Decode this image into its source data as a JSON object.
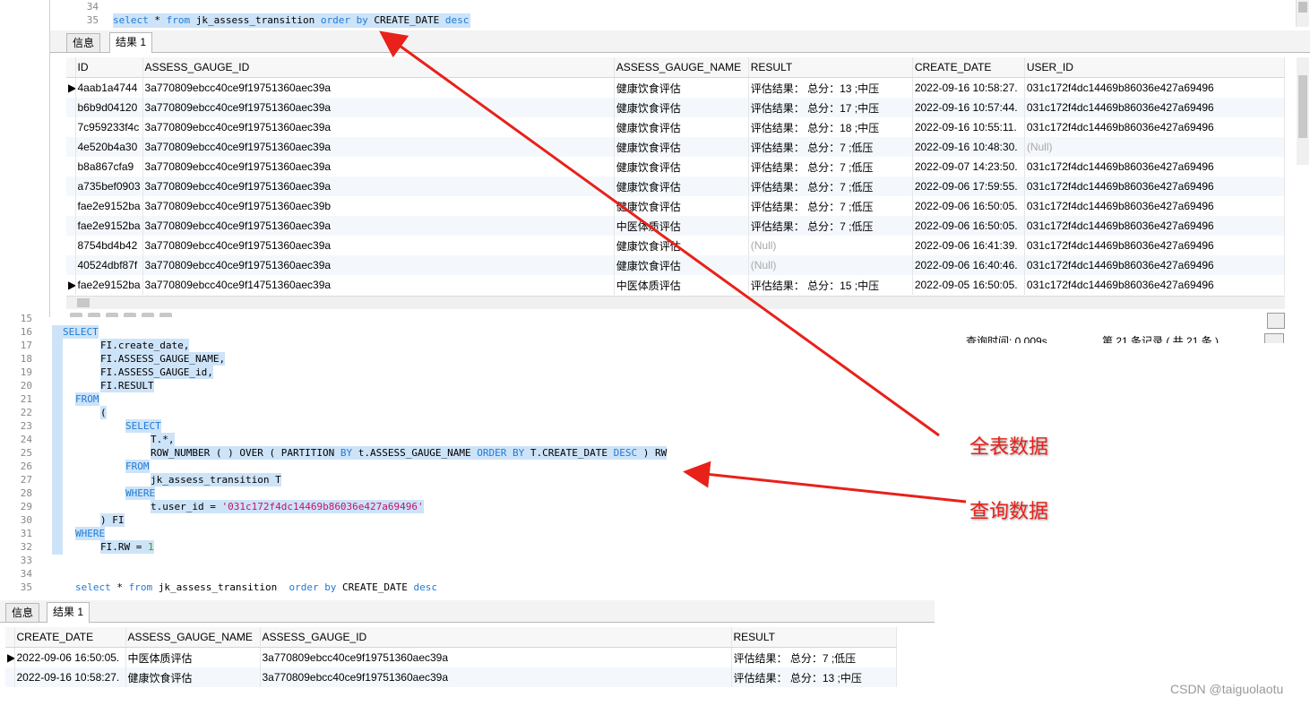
{
  "top": {
    "editor_lines": [
      {
        "n": "34",
        "code": ""
      },
      {
        "n": "35",
        "code_parts": [
          "select",
          " * ",
          "from",
          " jk_assess_transition  ",
          "order by",
          " CREATE_DATE ",
          "desc"
        ]
      }
    ],
    "tabs": [
      "信息",
      "结果 1"
    ],
    "columns": [
      "ID",
      "ASSESS_GAUGE_ID",
      "ASSESS_GAUGE_NAME",
      "RESULT",
      "CREATE_DATE",
      "USER_ID"
    ],
    "rows": [
      [
        "4aab1a4744",
        "3a770809ebcc40ce9f19751360aec39a",
        "健康饮食评估",
        "评估结果： 总分：13 ;中压",
        "2022-09-16 10:58:27.",
        "031c172f4dc14469b86036e427a69496"
      ],
      [
        "b6b9d04120",
        "3a770809ebcc40ce9f19751360aec39a",
        "健康饮食评估",
        "评估结果： 总分：17 ;中压",
        "2022-09-16 10:57:44.",
        "031c172f4dc14469b86036e427a69496"
      ],
      [
        "7c959233f4c",
        "3a770809ebcc40ce9f19751360aec39a",
        "健康饮食评估",
        "评估结果： 总分：18 ;中压",
        "2022-09-16 10:55:11.",
        "031c172f4dc14469b86036e427a69496"
      ],
      [
        "4e520b4a30",
        "3a770809ebcc40ce9f19751360aec39a",
        "健康饮食评估",
        "评估结果： 总分：7 ;低压",
        "2022-09-16 10:48:30.",
        "(Null)"
      ],
      [
        "b8a867cfa9",
        "3a770809ebcc40ce9f19751360aec39a",
        "健康饮食评估",
        "评估结果： 总分：7 ;低压",
        "2022-09-07 14:23:50.",
        "031c172f4dc14469b86036e427a69496"
      ],
      [
        "a735bef0903",
        "3a770809ebcc40ce9f19751360aec39a",
        "健康饮食评估",
        "评估结果： 总分：7 ;低压",
        "2022-09-06 17:59:55.",
        "031c172f4dc14469b86036e427a69496"
      ],
      [
        "fae2e9152ba",
        "3a770809ebcc40ce9f19751360aec39b",
        "健康饮食评估",
        "评估结果： 总分：7 ;低压",
        "2022-09-06 16:50:05.",
        "031c172f4dc14469b86036e427a69496"
      ],
      [
        "fae2e9152ba",
        "3a770809ebcc40ce9f19751360aec39a",
        "中医体质评估",
        "评估结果： 总分：7 ;低压",
        "2022-09-06 16:50:05.",
        "031c172f4dc14469b86036e427a69496"
      ],
      [
        "8754bd4b42",
        "3a770809ebcc40ce9f19751360aec39a",
        "健康饮食评估",
        "(Null)",
        "2022-09-06 16:41:39.",
        "031c172f4dc14469b86036e427a69496"
      ],
      [
        "40524dbf87f",
        "3a770809ebcc40ce9f19751360aec39a",
        "健康饮食评估",
        "(Null)",
        "2022-09-06 16:40:46.",
        "031c172f4dc14469b86036e427a69496"
      ],
      [
        "fae2e9152ba",
        "3a770809ebcc40ce9f14751360aec39a",
        "中医体质评估",
        "评估结果： 总分：15 ;中压",
        "2022-09-05 16:50:05.",
        "031c172f4dc14469b86036e427a69496"
      ]
    ],
    "status_query_time": "查询时间: 0.009s",
    "status_records": "第 21 条记录 ( 共 21 条 )"
  },
  "bottom": {
    "editor_lines": [
      {
        "n": "15",
        "code": ""
      },
      {
        "n": "16",
        "parts": [
          [
            "kw",
            "SELECT"
          ]
        ],
        "indent": 0,
        "sel": true
      },
      {
        "n": "17",
        "parts": [
          [
            "",
            "FI.create_date,"
          ]
        ],
        "indent": 3,
        "sel": true
      },
      {
        "n": "18",
        "parts": [
          [
            "",
            "FI.ASSESS_GAUGE_NAME,"
          ]
        ],
        "indent": 3,
        "sel": true
      },
      {
        "n": "19",
        "parts": [
          [
            "",
            "FI.ASSESS_GAUGE_id,"
          ]
        ],
        "indent": 3,
        "sel": true
      },
      {
        "n": "20",
        "parts": [
          [
            "",
            "FI.RESULT"
          ]
        ],
        "indent": 3,
        "sel": true
      },
      {
        "n": "21",
        "parts": [
          [
            "kw",
            "FROM"
          ]
        ],
        "indent": 1,
        "sel": true
      },
      {
        "n": "22",
        "parts": [
          [
            "",
            "("
          ]
        ],
        "indent": 3,
        "sel": true
      },
      {
        "n": "23",
        "parts": [
          [
            "kw",
            "SELECT"
          ]
        ],
        "indent": 5,
        "sel": true
      },
      {
        "n": "24",
        "parts": [
          [
            "",
            "T.*,"
          ]
        ],
        "indent": 7,
        "sel": true
      },
      {
        "n": "25",
        "parts": [
          [
            "",
            "ROW_NUMBER ( ) OVER ( PARTITION "
          ],
          [
            "kw",
            "BY"
          ],
          [
            "",
            " t.ASSESS_GAUGE_NAME "
          ],
          [
            "kw",
            "ORDER BY"
          ],
          [
            "",
            " T.CREATE_DATE "
          ],
          [
            "kw",
            "DESC"
          ],
          [
            "",
            " ) RW"
          ]
        ],
        "indent": 7,
        "sel": true
      },
      {
        "n": "26",
        "parts": [
          [
            "kw",
            "FROM"
          ]
        ],
        "indent": 5,
        "sel": true
      },
      {
        "n": "27",
        "parts": [
          [
            "",
            "jk_assess_transition T"
          ]
        ],
        "indent": 7,
        "sel": true
      },
      {
        "n": "28",
        "parts": [
          [
            "kw",
            "WHERE"
          ]
        ],
        "indent": 5,
        "sel": true
      },
      {
        "n": "29",
        "parts": [
          [
            "",
            "t.user_id = "
          ],
          [
            "str",
            "'031c172f4dc14469b86036e427a69496'"
          ]
        ],
        "indent": 7,
        "sel": true
      },
      {
        "n": "30",
        "parts": [
          [
            "",
            ") FI"
          ]
        ],
        "indent": 3,
        "sel": true
      },
      {
        "n": "31",
        "parts": [
          [
            "kw",
            "WHERE"
          ]
        ],
        "indent": 1,
        "sel": true
      },
      {
        "n": "32",
        "parts": [
          [
            "",
            "FI.RW = "
          ],
          [
            "num",
            "1"
          ]
        ],
        "indent": 3,
        "sel": true
      },
      {
        "n": "33",
        "parts": [],
        "indent": 0,
        "sel": false
      },
      {
        "n": "34",
        "parts": [],
        "indent": 0,
        "sel": false
      },
      {
        "n": "35",
        "parts": [
          [
            "kw",
            "select"
          ],
          [
            "",
            " * "
          ],
          [
            "kw",
            "from"
          ],
          [
            "",
            " jk_assess_transition  "
          ],
          [
            "kw",
            "order by"
          ],
          [
            "",
            " CREATE_DATE "
          ],
          [
            "kw",
            "desc"
          ]
        ],
        "indent": 1,
        "sel": false
      }
    ],
    "tabs": [
      "信息",
      "结果 1"
    ],
    "columns": [
      "CREATE_DATE",
      "ASSESS_GAUGE_NAME",
      "ASSESS_GAUGE_ID",
      "RESULT"
    ],
    "rows": [
      [
        "2022-09-06 16:50:05.",
        "中医体质评估",
        "3a770809ebcc40ce9f19751360aec39a",
        "评估结果： 总分：7 ;低压"
      ],
      [
        "2022-09-16 10:58:27.",
        "健康饮食评估",
        "3a770809ebcc40ce9f19751360aec39a",
        "评估结果： 总分：13 ;中压"
      ]
    ]
  },
  "annotations": {
    "full_table": "全表数据",
    "query_data": "查询数据",
    "color": "#e8211a"
  },
  "watermark": "CSDN @taiguolaotu"
}
